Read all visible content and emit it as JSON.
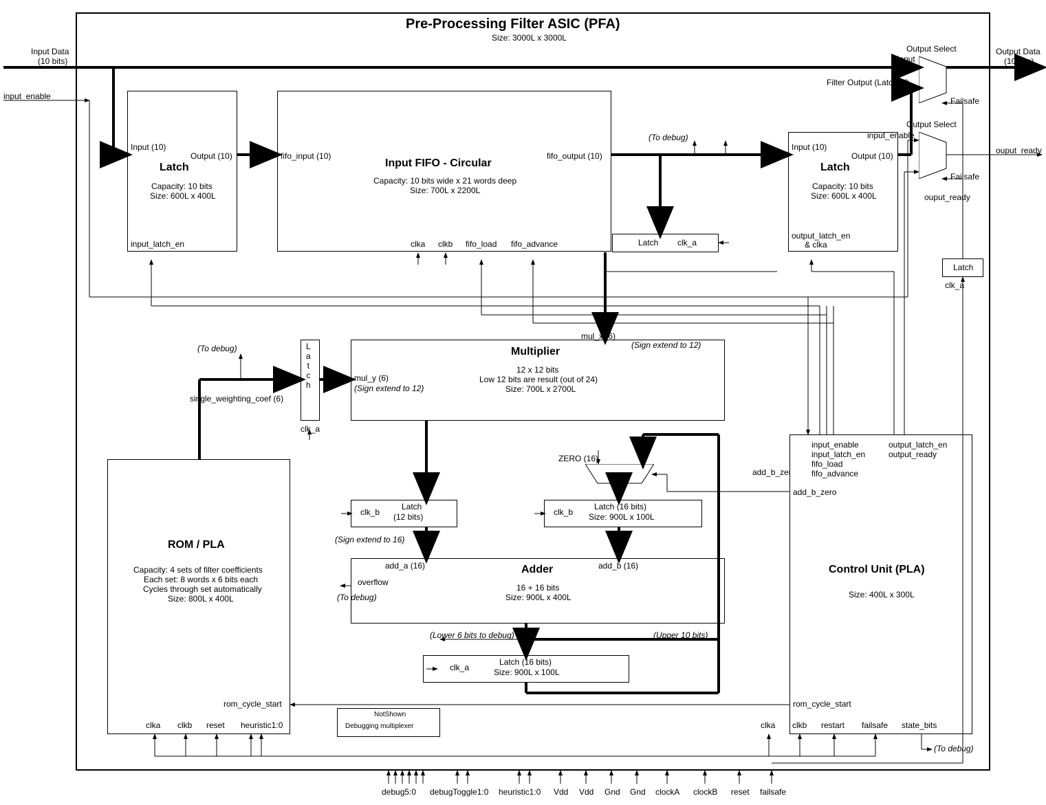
{
  "main": {
    "title": "Pre-Processing Filter ASIC (PFA)",
    "size": "Size: 3000L x 3000L"
  },
  "ext": {
    "input_data": "Input Data",
    "input_data_bits": "(10 bits)",
    "input_enable": "input_enable",
    "output_data": "Output Data",
    "output_data_bits": "(10 bits)",
    "output_ready": "ouput_ready"
  },
  "latch1": {
    "name": "Latch",
    "capacity": "Capacity: 10 bits",
    "size": "Size: 600L x 400L",
    "in": "Input (10)",
    "out": "Output (10)",
    "en": "input_latch_en"
  },
  "fifo": {
    "name": "Input  FIFO - Circular",
    "capacity": "Capacity: 10 bits wide x 21 words deep",
    "size": "Size: 700L x 2200L",
    "in": "fifo_input (10)",
    "out": "fifo_output (10)",
    "clka": "clka",
    "clkb": "clkb",
    "load": "fifo_load",
    "adv": "fifo_advance"
  },
  "latch_fifo_out": {
    "name": "Latch",
    "clk": "clk_a"
  },
  "vlatch": {
    "name": "L\na\nt\nc\nh",
    "clk": "clk_a"
  },
  "mult": {
    "name": "Multiplier",
    "spec": "12 x 12 bits",
    "note": "Low 12 bits are result (out of 24)",
    "size": "Size: 700L x 2700L",
    "mul_x": "mul_x (6)",
    "mul_x_ext": "(Sign extend to 12)",
    "mul_y": "mul_y (6)",
    "mul_y_ext": "(Sign extend to 12)"
  },
  "mux_add_b": {
    "zero": "ZERO (16)",
    "out": "add_b_zero"
  },
  "latch_a": {
    "name": "Latch",
    "bits": "(12 bits)",
    "clk": "clk_b",
    "ext": "(Sign extend to 16)"
  },
  "latch_b": {
    "name": "Latch (16 bits)",
    "size": "Size: 900L x 100L",
    "clk": "clk_b"
  },
  "adder": {
    "name": "Adder",
    "spec": "16 + 16 bits",
    "size": "Size: 900L x 400L",
    "add_a": "add_a (16)",
    "add_b": "add_b (16)",
    "overf": "overflow",
    "lower": "(Lower 6 bits to debug)",
    "upper": "(Upper 10 bits)"
  },
  "latch_sum": {
    "name": "Latch (16 bits)",
    "size": "Size: 900L x 100L",
    "clk": "clk_a"
  },
  "rom": {
    "name": "ROM / PLA",
    "l1": "Capacity: 4 sets of filter coefficients",
    "l2": "Each set: 8 words x 6 bits each",
    "l3": "Cycles through set automatically",
    "size": "Size: 800L x 400L",
    "cycle": "rom_cycle_start",
    "clka": "clka",
    "clkb": "clkb",
    "reset": "reset",
    "heur": "heuristic1:0",
    "coef": "single_weighting_coef (6)"
  },
  "debug_box": {
    "l1": "NotShown",
    "l2": "Debugging  multiplexer"
  },
  "latch2": {
    "name": "Latch",
    "capacity": "Capacity: 10 bits",
    "size": "Size: 600L x 400L",
    "in": "Input (10)",
    "out": "Output (10)",
    "en1": "output_latch_en",
    "en2": "& clka"
  },
  "mux1": {
    "name": "Output Select",
    "a": "Input",
    "b": "Filter Output (Latched)",
    "fs": "Failsafe"
  },
  "mux2": {
    "name": "Output Select",
    "a": "input_enable",
    "fs": "Failsafe",
    "out": "ouput_ready"
  },
  "latch_small": {
    "name": "Latch",
    "clk": "clk_a"
  },
  "cu": {
    "name": "Control Unit (PLA)",
    "size": "Size: 400L x 300L",
    "in1": "input_enable",
    "in2": "input_latch_en",
    "in3": "fifo_load",
    "in4": "fifo_advance",
    "out1": "output_latch_en",
    "out2": "output_ready",
    "cycle": "rom_cycle_start",
    "clka": "clka",
    "clkb": "clkb",
    "restart": "restart",
    "fs": "failsafe",
    "sb": "state_bits"
  },
  "to_debug": "(To debug)",
  "bottom": {
    "debug": "debug5:0",
    "dtog": "debugToggle1:0",
    "heur": "heuristic1:0",
    "vdd": "Vdd",
    "gnd": "Gnd",
    "clka": "clockA",
    "clkb": "clockB",
    "reset": "reset",
    "failsafe": "failsafe"
  }
}
